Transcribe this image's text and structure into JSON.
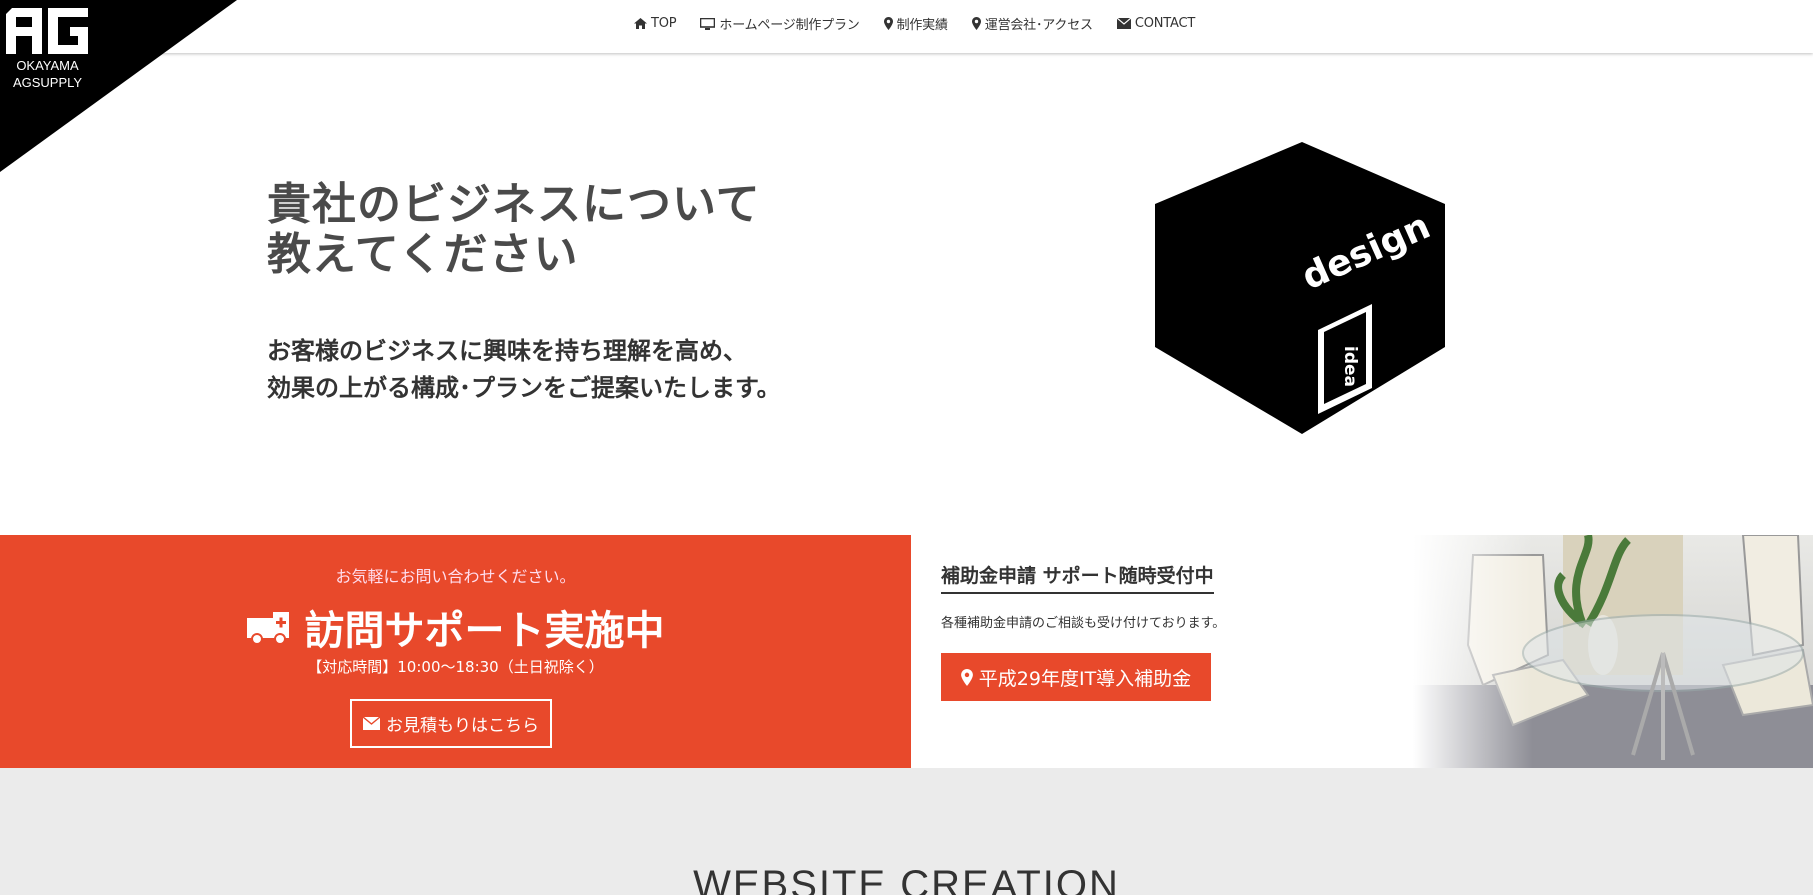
{
  "logo": {
    "mark": "AG",
    "line1": "OKAYAMA",
    "line2": "AGSUPPLY"
  },
  "nav": [
    {
      "icon": "home-icon",
      "label": "TOP"
    },
    {
      "icon": "monitor-icon",
      "label": "ホームページ制作プラン"
    },
    {
      "icon": "map-marker-icon",
      "label": "制作実績"
    },
    {
      "icon": "map-marker-icon",
      "label": "運営会社･アクセス"
    },
    {
      "icon": "envelope-icon",
      "label": "CONTACT"
    }
  ],
  "hero": {
    "title_line1": "貴社のビジネスについて",
    "title_line2": "教えてください",
    "sub_line1": "お客様のビジネスに興味を持ち理解を高め、",
    "sub_line2": "効果の上がる構成･プランをご提案いたします。",
    "cube_word": "design",
    "door_word": "idea"
  },
  "support": {
    "small": "お気軽にお問い合わせください。",
    "title": "訪問サポート実施中",
    "hours": "【対応時間】10:00〜18:30（土日祝除く）",
    "button": "お見積もりはこちら"
  },
  "subsidy": {
    "title": "補助金申請 サポート随時受付中",
    "desc": "各種補助金申請のご相談も受け付けております。",
    "button": "平成29年度IT導入補助金"
  },
  "section": {
    "heading": "WEBSITE CREATION"
  },
  "colors": {
    "accent": "#e8492b",
    "grey": "#ebebeb"
  }
}
